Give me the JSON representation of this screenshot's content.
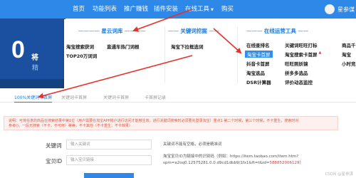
{
  "nav": {
    "items": [
      "首页",
      "功能列表",
      "推广赚钱",
      "插件安装",
      "在线工具",
      "购买"
    ],
    "tools_caret": "▼",
    "user": "星参谋"
  },
  "hero": {
    "big_digit": "0",
    "subtitle": "将",
    "line": "精"
  },
  "mega": {
    "col1": {
      "title": "星云词库",
      "links": [
        "淘宝搜索获词",
        "直通车热门词根",
        "TOP20万词词"
      ]
    },
    "col2": {
      "title": "关键词挖掘",
      "links": [
        "淘宝下拉框选词"
      ]
    },
    "col3": {
      "title": "在线运营工具",
      "left": [
        "在线查排名",
        "淘宝卡首屏",
        "抖音卡首屏",
        "淘宝选品",
        "DSR计算器"
      ],
      "mid": [
        "关键词旺旺打标",
        "淘宝搜索卡首屏",
        "旺旺照妖镜",
        "拼多多选品",
        "评价动态监控"
      ],
      "right": [
        "商品千",
        "淘宝",
        "小时竞品"
      ]
    }
  },
  "tabs": [
    "100%关键词卡首屏",
    "关键词卡首屏",
    "关键词卡首屏",
    "卡首屏记录"
  ],
  "notice": {
    "line1": "说明：可将任意的商品在搜索结果中第1位（用户需要在淘宝APP账户进行访问才能够生效，进行关键词搜索时必须要先登录淘宝）重点1·第二个时候，第三个时候，不卡重生，搜索时对",
    "line2": "参考()，一段无搜索（不卡，不可用）等等，不卡其他（不卡重生，不卡效果）"
  },
  "form": {
    "keyword": {
      "label": "关键词",
      "placeholder": "输入关键词",
      "hint": "关键词不能有空格，必须是精准词"
    },
    "item_id": {
      "label": "宝贝ID",
      "placeholder": "输入宝贝链接",
      "hint1": "淘宝宝贝ID为链接中的识别码（例如：https://item.taobao.com/item.htm?",
      "hint2": "spm=a2oq0.12575281.0.0.d9cd1dbb9/1fx1&ft=t&id=",
      "hint2_red": "588852006129",
      "hint2_end": "）"
    }
  },
  "watermark": "CSDN @星参谋",
  "colors": {
    "nav_bg": "#2e88e8",
    "hero_bg": "#1b4fa0",
    "accent": "#1f7bd9",
    "highlight": "#2f8ff0",
    "annotation": "#e6322b"
  }
}
